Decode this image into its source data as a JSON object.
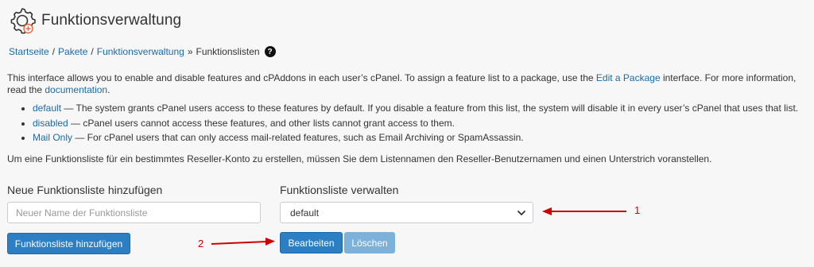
{
  "header": {
    "title": "Funktionsverwaltung"
  },
  "breadcrumb": {
    "items": [
      "Startseite",
      "Pakete",
      "Funktionsverwaltung"
    ],
    "separator": "/",
    "last_separator": "»",
    "current": "Funktionslisten",
    "help": "?"
  },
  "intro": {
    "text_before_link": "This interface allows you to enable and disable features and cPAddons in each user’s cPanel. To assign a feature list to a package, use the ",
    "edit_package_link": "Edit a Package",
    "text_middle": " interface. For more information, read the ",
    "documentation_link": "documentation",
    "text_end": "."
  },
  "feature_lists": [
    {
      "name": "default",
      "description": " — The system grants cPanel users access to these features by default. If you disable a feature from this list, the system will disable it in every user’s cPanel that uses that list."
    },
    {
      "name": "disabled",
      "description": " — cPanel users cannot access these features, and other lists cannot grant access to them."
    },
    {
      "name": "Mail Only",
      "description": " — For cPanel users that can only access mail-related features, such as Email Archiving or SpamAssassin."
    }
  ],
  "prefix_note": "Um eine Funktionsliste für ein bestimmtes Reseller-Konto zu erstellen, müssen Sie dem Listennamen den Reseller-Benutzernamen und einen Unterstrich voranstellen.",
  "add_form": {
    "label": "Neue Funktionsliste hinzufügen",
    "placeholder": "Neuer Name der Funktionsliste",
    "value": "",
    "button": "Funktionsliste hinzufügen"
  },
  "manage_form": {
    "label": "Funktionsliste verwalten",
    "selected": "default",
    "edit_button": "Bearbeiten",
    "delete_button": "Löschen"
  },
  "annotations": {
    "one": "1",
    "two": "2"
  },
  "colors": {
    "accent": "#2d7fc4",
    "link": "#1b6aa5",
    "disabled_button": "#7cb1dc",
    "annotation": "#cc0000"
  }
}
